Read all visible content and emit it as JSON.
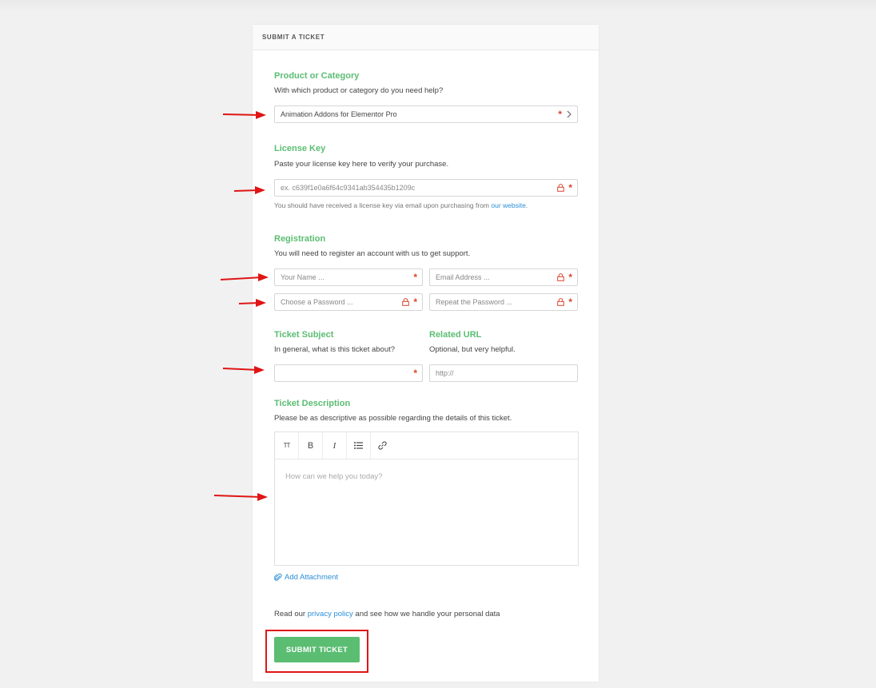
{
  "header": {
    "title": "SUBMIT A TICKET"
  },
  "product": {
    "title": "Product or Category",
    "desc": "With which product or category do you need help?",
    "value": "Animation Addons for Elementor Pro"
  },
  "license": {
    "title": "License Key",
    "desc": "Paste your license key here to verify your purchase.",
    "placeholder": "ex. c639f1e0a6f64c9341ab354435b1209c",
    "hint_prefix": "You should have received a license key via email upon purchasing from ",
    "hint_link": "our website",
    "hint_suffix": "."
  },
  "registration": {
    "title": "Registration",
    "desc": "You will need to register an account with us to get support.",
    "name_ph": "Your Name ...",
    "email_ph": "Email Address ...",
    "password_ph": "Choose a Password ...",
    "repeat_ph": "Repeat the Password ..."
  },
  "subject": {
    "title": "Ticket Subject",
    "desc": "In general, what is this ticket about?"
  },
  "related": {
    "title": "Related URL",
    "desc": "Optional, but very helpful.",
    "placeholder": "http://"
  },
  "description": {
    "title": "Ticket Description",
    "desc": "Please be as descriptive as possible regarding the details of this ticket.",
    "placeholder": "How can we help you today?",
    "tools": [
      "TT",
      "B",
      "I",
      "list",
      "link"
    ]
  },
  "attachment": {
    "label": "Add Attachment"
  },
  "privacy": {
    "prefix": "Read our ",
    "link": "privacy policy",
    "suffix": " and see how we handle your personal data"
  },
  "submit": {
    "label": "SUBMIT TICKET"
  },
  "colors": {
    "accent": "#5bbd72",
    "required": "#d9442e",
    "link": "#2b8fd8",
    "annotation": "#e01515"
  }
}
